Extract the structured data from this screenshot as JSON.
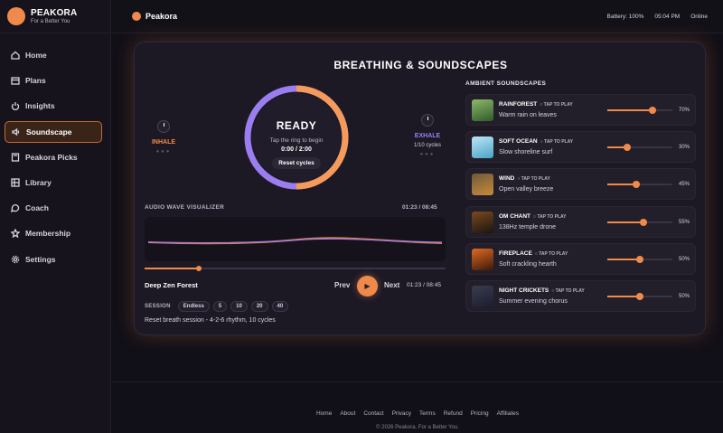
{
  "brand": {
    "name": "PEAKORA",
    "tagline": "For a Better You",
    "color": "#f08a4b"
  },
  "nav": [
    {
      "label": "Home",
      "icon": "home-icon"
    },
    {
      "label": "Plans",
      "icon": "calendar-icon"
    },
    {
      "label": "Insights",
      "icon": "power-icon"
    },
    {
      "label": "Soundscape",
      "icon": "speaker-icon",
      "active": true
    },
    {
      "label": "Peakora Picks",
      "icon": "book-icon"
    },
    {
      "label": "Library",
      "icon": "library-icon"
    },
    {
      "label": "Coach",
      "icon": "chat-icon"
    },
    {
      "label": "Membership",
      "icon": "star-icon"
    },
    {
      "label": "Settings",
      "icon": "gear-icon"
    }
  ],
  "topbar": {
    "brand": "Peakora",
    "battery": "Battery: 100%",
    "time": "05:04 PM",
    "status": "Online"
  },
  "main": {
    "title": "BREATHING & SOUNDSCAPES",
    "inhale": "INHALE",
    "exhale": "EXHALE",
    "cycles": "1/10 cycles",
    "ring": {
      "state": "READY",
      "hint": "Tap the ring to begin",
      "time": "0:00 / 2:00",
      "reset": "Reset cycles",
      "progress": 0.5
    },
    "visualizer": {
      "label": "AUDIO WAVE VISUALIZER",
      "time": "01:23 / 08:45"
    },
    "player": {
      "track": "Deep Zen Forest",
      "prev": "Prev",
      "next": "Next",
      "time": "01:23 / 08:45",
      "progress": 0.18
    },
    "session": {
      "label": "SESSION",
      "options": [
        "Endless",
        "5",
        "10",
        "20",
        "40"
      ],
      "description": "Reset breath session - 4-2-6 rhythm, 10 cycles"
    }
  },
  "ambient": {
    "label": "AMBIENT SOUNDSCAPES",
    "tap": "○ TAP TO PLAY",
    "items": [
      {
        "name": "RAINFOREST",
        "sub": "Warm rain on leaves",
        "volume": 70,
        "volume_label": "70%",
        "colors": [
          "#2f5a2a",
          "#8fb96a"
        ]
      },
      {
        "name": "SOFT OCEAN",
        "sub": "Slow shoreline surf",
        "volume": 30,
        "volume_label": "30%",
        "colors": [
          "#4aa3c9",
          "#bde6f2"
        ]
      },
      {
        "name": "WIND",
        "sub": "Open valley breeze",
        "volume": 45,
        "volume_label": "45%",
        "colors": [
          "#c98a3a",
          "#6e5a3a"
        ]
      },
      {
        "name": "OM CHANT",
        "sub": "138Hz temple drone",
        "volume": 55,
        "volume_label": "55%",
        "colors": [
          "#1a1410",
          "#7a4a20"
        ]
      },
      {
        "name": "FIREPLACE",
        "sub": "Soft crackling hearth",
        "volume": 50,
        "volume_label": "50%",
        "colors": [
          "#3a1a0c",
          "#e06a20"
        ]
      },
      {
        "name": "NIGHT CRICKETS",
        "sub": "Summer evening chorus",
        "volume": 50,
        "volume_label": "50%",
        "colors": [
          "#1b1d2e",
          "#3a3c50"
        ]
      }
    ]
  },
  "footer": {
    "links": [
      "Home",
      "About",
      "Contact",
      "Privacy",
      "Terms",
      "Refund",
      "Pricing",
      "Affiliates"
    ],
    "copyright": "© 2026 Peakora. For a Better You."
  }
}
